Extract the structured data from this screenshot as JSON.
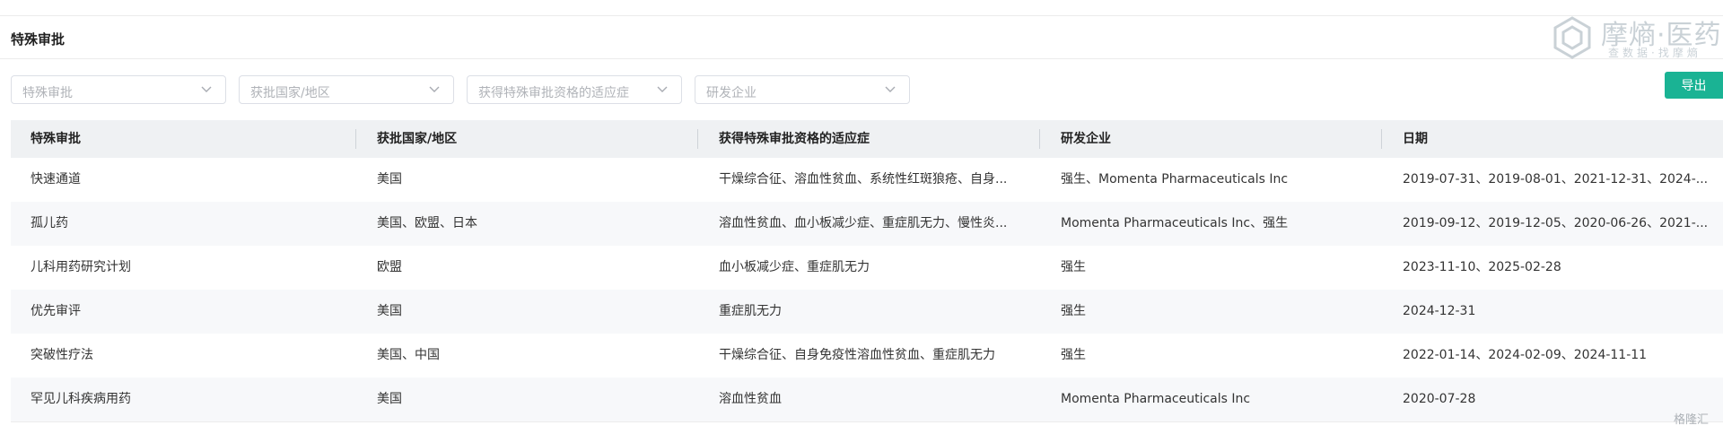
{
  "section": {
    "title": "特殊审批"
  },
  "watermark": {
    "title": "摩熵·医药",
    "subtitle": "查数据·找摩熵"
  },
  "filters": [
    {
      "placeholder": "特殊审批"
    },
    {
      "placeholder": "获批国家/地区"
    },
    {
      "placeholder": "获得特殊审批资格的适应症"
    },
    {
      "placeholder": "研发企业"
    }
  ],
  "export": {
    "label": "导出"
  },
  "table": {
    "headers": [
      "特殊审批",
      "获批国家/地区",
      "获得特殊审批资格的适应症",
      "研发企业",
      "日期"
    ],
    "rows": [
      [
        "快速通道",
        "美国",
        "干燥综合征、溶血性贫血、系统性红斑狼疮、自身...",
        "强生、Momenta Pharmaceuticals Inc",
        "2019-07-31、2019-08-01、2021-12-31、2024-..."
      ],
      [
        "孤儿药",
        "美国、欧盟、日本",
        "溶血性贫血、血小板减少症、重症肌无力、慢性炎...",
        "Momenta Pharmaceuticals Inc、强生",
        "2019-09-12、2019-12-05、2020-06-26、2021-..."
      ],
      [
        "儿科用药研究计划",
        "欧盟",
        "血小板减少症、重症肌无力",
        "强生",
        "2023-11-10、2025-02-28"
      ],
      [
        "优先审评",
        "美国",
        "重症肌无力",
        "强生",
        "2024-12-31"
      ],
      [
        "突破性疗法",
        "美国、中国",
        "干燥综合征、自身免疫性溶血性贫血、重症肌无力",
        "强生",
        "2022-01-14、2024-02-09、2024-11-11"
      ],
      [
        "罕见儿科疾病用药",
        "美国",
        "溶血性贫血",
        "Momenta Pharmaceuticals Inc",
        "2020-07-28"
      ]
    ]
  },
  "corner_mark": "格隆汇",
  "colors": {
    "accent": "#1ab394",
    "header_bg": "#eff1f3",
    "row_alt_bg": "#f7f8fa"
  },
  "icons": {
    "filter_dropdown": "chevron-down-icon",
    "watermark_logo": "hexagon-logo-icon"
  }
}
